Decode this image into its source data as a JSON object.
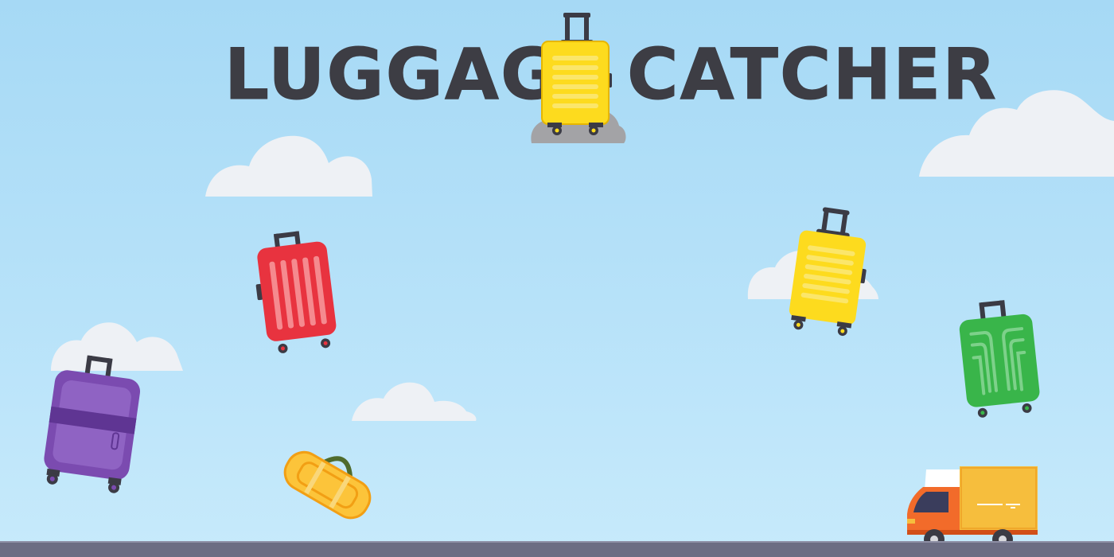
{
  "game": {
    "title_left": "LUGGAGE",
    "title_right": "CATCHER"
  },
  "scene": {
    "sky_color": "#a6d9f5",
    "ground_color": "#6c6d83",
    "cloud_color": "#eef1f5"
  },
  "objects": [
    {
      "name": "red-suitcase",
      "color": "#e8333f"
    },
    {
      "name": "yellow-suitcase",
      "color": "#fddb1e"
    },
    {
      "name": "green-suitcase",
      "color": "#39b54a"
    },
    {
      "name": "purple-suitcase",
      "color": "#7b4bb0"
    },
    {
      "name": "yellow-duffel-bag",
      "color": "#fcc43a"
    },
    {
      "name": "delivery-truck",
      "color": "#f26b2a"
    }
  ]
}
